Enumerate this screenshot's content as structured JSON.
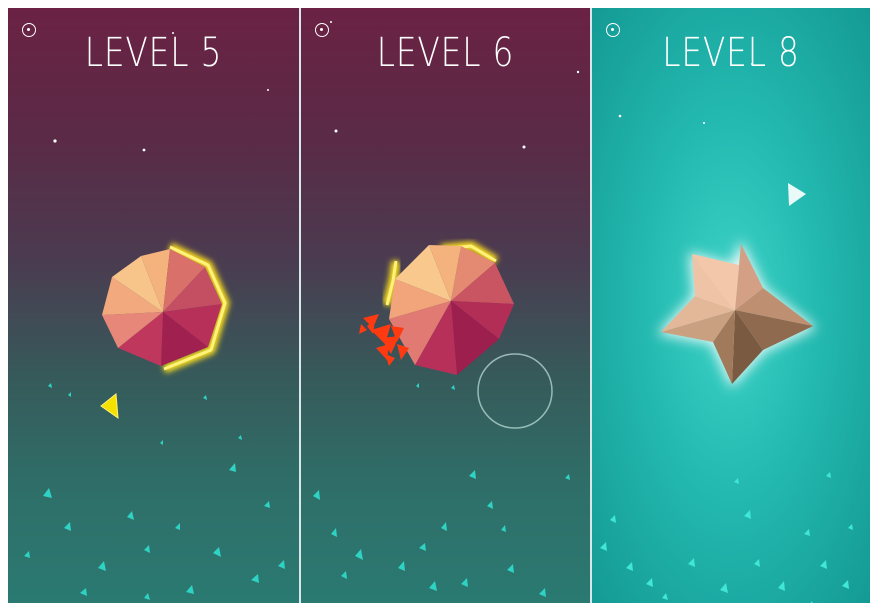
{
  "screens": [
    {
      "title": "LEVEL 5",
      "menu_icon": "target-circle-icon"
    },
    {
      "title": "LEVEL 6",
      "menu_icon": "target-circle-icon"
    },
    {
      "title": "LEVEL 8",
      "menu_icon": "target-circle-icon"
    }
  ],
  "colors": {
    "bg_top": "#6b2244",
    "bg_bottom": "#2a7a72",
    "bg_teal": "#23b9b0",
    "shield_glow": "#ffe21a",
    "player_ship": "#f5e000",
    "impact": "#ff3a10",
    "particle": "#2fd3c3"
  }
}
